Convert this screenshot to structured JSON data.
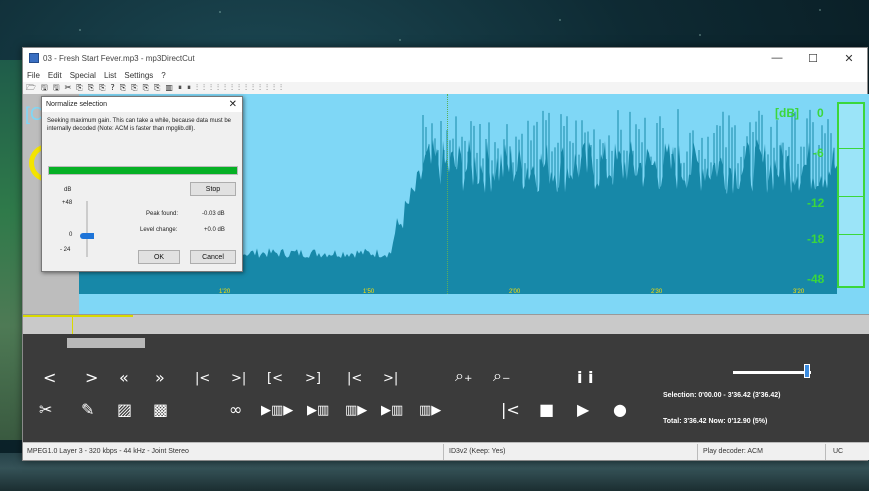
{
  "window": {
    "title": "03 - Fresh Start Fever.mp3 - mp3DirectCut",
    "min_glyph": "—",
    "max_glyph": "☐",
    "close_glyph": "✕"
  },
  "menu": [
    "File",
    "Edit",
    "Special",
    "List",
    "Settings",
    "?"
  ],
  "toolbar_glyphs": [
    "🗁",
    "🖫",
    "🖫",
    "✂",
    "⎘",
    "⎘",
    "⎘",
    "?",
    "⎘",
    "⎘",
    "⎘",
    "⎘",
    "▥",
    "⏸",
    "⏸",
    "⫶",
    "⫶",
    "⫶",
    "⫶",
    "⫶",
    "⫶",
    "⫶",
    "⫶",
    "⫶",
    "⫶",
    "⫶",
    "⫶",
    "⫶"
  ],
  "waveform": {
    "db_label": "[dB]",
    "db_levels": [
      "0",
      "-6",
      "-12",
      "-18",
      "-48"
    ],
    "timeline": [
      "1'20",
      "1'50",
      "2'00",
      "2'30",
      "3'20"
    ],
    "left_bracket": "[C"
  },
  "dialog": {
    "title": "Normalize selection",
    "close": "✕",
    "message": "Seeking maximum gain. This can take a while, because data must be internally decoded (Note: ACM is faster than mpglib.dll).",
    "progress_percent": 100,
    "stop_label": "Stop",
    "db_unit": "dB",
    "scale_top": "+48",
    "scale_mid": "0",
    "scale_bottom": "- 24",
    "peak_label": "Peak found:",
    "peak_value": "-0.03 dB",
    "level_label": "Level change:",
    "level_value": "+0.0 dB",
    "ok_label": "OK",
    "cancel_label": "Cancel"
  },
  "controls": {
    "row1": [
      "<",
      ">",
      "«",
      "»",
      "|<",
      ">|",
      "[<",
      ">]",
      "|<",
      ">|"
    ],
    "zoom_in": "⌕₊",
    "zoom_out": "⌕₋",
    "info_icon": "i i",
    "row2_edit": [
      "✂",
      "✎",
      "▨",
      "▩"
    ],
    "row2_loop": [
      "∞",
      "▶▥▶",
      "▶▥",
      "▥▶",
      "▶▥",
      "▥▶"
    ],
    "row2_play": [
      "|<",
      "■",
      "▶",
      "●"
    ],
    "selection": "Selection: 0'00.00 - 3'36.42 (3'36.42)",
    "total": "Total: 3'36.42  Now: 0'12.90  (5%)",
    "volume_percent": 95
  },
  "status": {
    "format": "MPEG1.0 Layer 3 - 320 kbps - 44 kHz - Joint Stereo",
    "id3": "ID3v2 (Keep: Yes)",
    "decoder": "Play decoder: ACM",
    "uc": "UC"
  },
  "colors": {
    "wave_bg": "#7fd7f6",
    "wave_fg": "#1788a8",
    "accent_green": "#3bd73b",
    "progress_green": "#06b025"
  }
}
